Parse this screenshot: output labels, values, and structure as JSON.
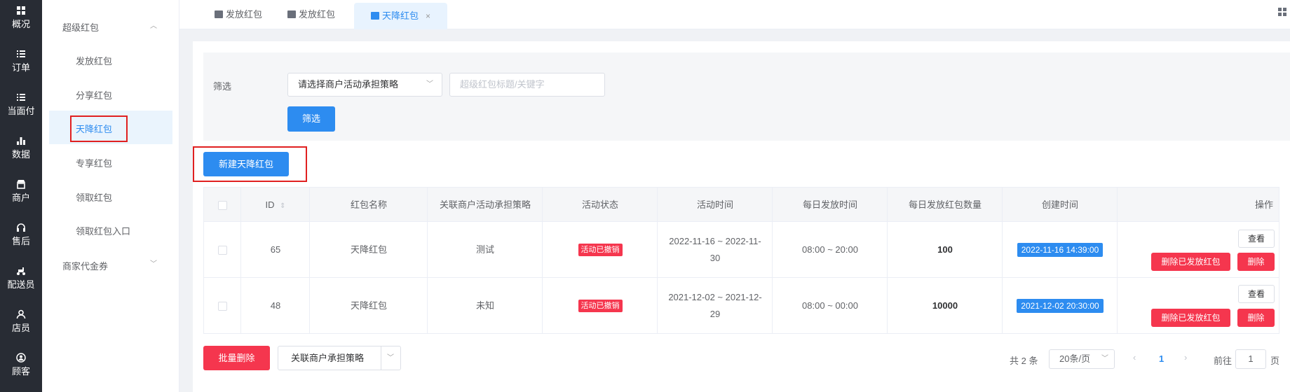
{
  "rail": [
    {
      "label": "概况",
      "icon": "dashboard-icon"
    },
    {
      "label": "订单",
      "icon": "list-icon"
    },
    {
      "label": "当面付",
      "icon": "list-icon"
    },
    {
      "label": "数据",
      "icon": "bar-chart-icon"
    },
    {
      "label": "商户",
      "icon": "store-icon"
    },
    {
      "label": "售后",
      "icon": "headset-icon"
    },
    {
      "label": "配送员",
      "icon": "scooter-icon"
    },
    {
      "label": "店员",
      "icon": "person-icon"
    },
    {
      "label": "顾客",
      "icon": "user-circle-icon"
    }
  ],
  "submenu": {
    "group1": "超级红包",
    "items": [
      "发放红包",
      "分享红包",
      "天降红包",
      "专享红包",
      "领取红包",
      "领取红包入口"
    ],
    "active": "天降红包",
    "group2": "商家代金券"
  },
  "tabs": [
    {
      "label": "发放红包"
    },
    {
      "label": "发放红包"
    },
    {
      "label": "天降红包",
      "active": true
    }
  ],
  "tab_close": "×",
  "filter": {
    "label": "筛选",
    "select_value": "请选择商户活动承担策略",
    "input_placeholder": "超级红包标题/关键字",
    "button": "筛选"
  },
  "new_button": "新建天降红包",
  "table": {
    "headers": [
      "ID",
      "红包名称",
      "关联商户活动承担策略",
      "活动状态",
      "活动时间",
      "每日发放时间",
      "每日发放红包数量",
      "创建时间",
      "操作"
    ],
    "rows": [
      {
        "id": "65",
        "name": "天降红包",
        "strategy": "测试",
        "status": "活动已撤销",
        "time_line1": "2022-11-16 ~ 2022-11-",
        "time_line2": "30",
        "daily_time": "08:00 ~ 20:00",
        "count": "100",
        "created": "2022-11-16 14:39:00"
      },
      {
        "id": "48",
        "name": "天降红包",
        "strategy": "未知",
        "status": "活动已撤销",
        "time_line1": "2021-12-02 ~ 2021-12-",
        "time_line2": "29",
        "daily_time": "08:00 ~ 00:00",
        "count": "10000",
        "created": "2021-12-02 20:30:00"
      }
    ],
    "actions": {
      "view": "查看",
      "delete_issued": "删除已发放红包",
      "delete": "删除"
    }
  },
  "footer": {
    "batch_delete": "批量删除",
    "strategy_button": "关联商户承担策略",
    "total": "共 2 条",
    "page_size": "20条/页",
    "current_page": "1",
    "goto_label": "前往",
    "goto_value": "1",
    "goto_suffix": "页"
  },
  "colors": {
    "primary": "#2d8cf0",
    "danger": "#f5364e",
    "rail": "#282c34",
    "highlight_box": "#e02020"
  }
}
